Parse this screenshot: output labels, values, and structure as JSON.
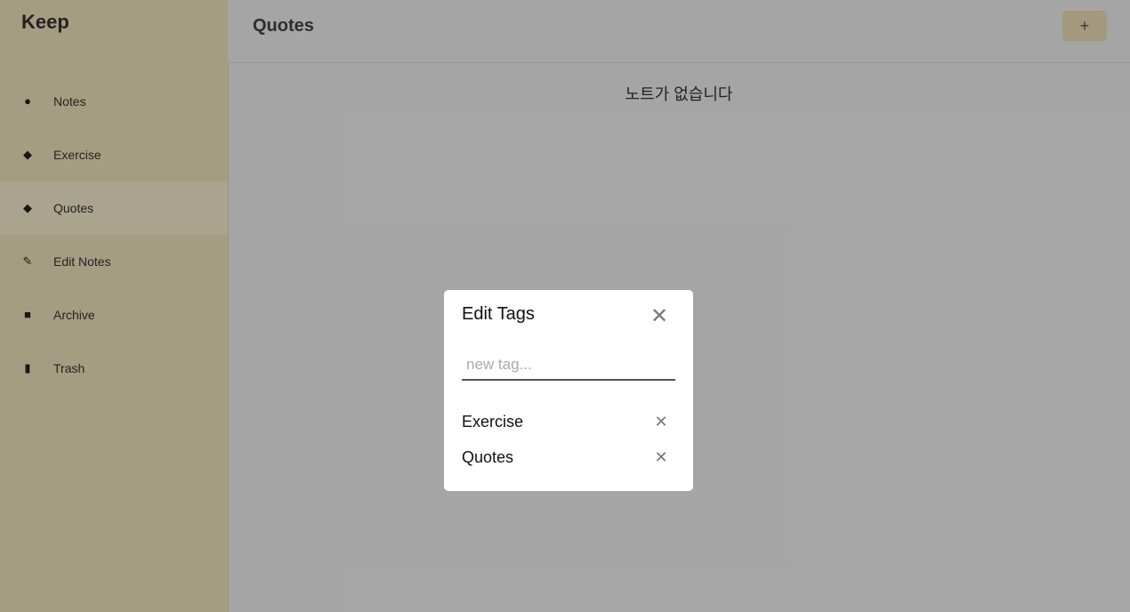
{
  "sidebar": {
    "title": "Keep",
    "items": [
      {
        "label": "Notes",
        "icon": "lightbulb-icon"
      },
      {
        "label": "Exercise",
        "icon": "tag-icon"
      },
      {
        "label": "Quotes",
        "icon": "tag-icon"
      },
      {
        "label": "Edit Notes",
        "icon": "pencil-icon"
      },
      {
        "label": "Archive",
        "icon": "archive-icon"
      },
      {
        "label": "Trash",
        "icon": "trash-icon"
      }
    ],
    "active_index": 2
  },
  "header": {
    "title": "Quotes",
    "add_label": "+"
  },
  "main": {
    "empty_message": "노트가 없습니다"
  },
  "modal": {
    "title": "Edit Tags",
    "close_label": "✕",
    "input": {
      "placeholder": "new tag...",
      "value": ""
    },
    "tags": [
      {
        "label": "Exercise",
        "delete_label": "✕"
      },
      {
        "label": "Quotes",
        "delete_label": "✕"
      }
    ]
  },
  "colors": {
    "sidebar_bg": "#f4e7c0",
    "overlay": "rgba(0,0,0,0.32)",
    "modal_bg": "#ffffff"
  }
}
